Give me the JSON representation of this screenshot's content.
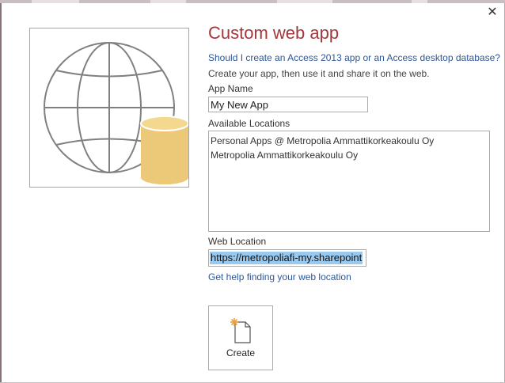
{
  "dialog": {
    "close_glyph": "✕",
    "title": "Custom web app",
    "question_link": "Should I create an Access 2013 app or an Access desktop database?",
    "description": "Create your app, then use it and share it on the web.",
    "app_name": {
      "label": "App Name",
      "value": "My New App"
    },
    "locations": {
      "label": "Available Locations",
      "items": [
        "Personal Apps @ Metropolia Ammattikorkeakoulu Oy",
        "Metropolia Ammattikorkeakoulu Oy"
      ]
    },
    "web_location": {
      "label": "Web Location",
      "value": "https://metropoliafi-my.sharepoint"
    },
    "help_link": "Get help finding your web location",
    "create_label": "Create"
  },
  "colors": {
    "title": "#a4373a",
    "link": "#2b579a",
    "selection": "#99c9ef",
    "globe_stroke": "#808080",
    "database": "#ecc978"
  },
  "icons": {
    "illustration": "globe-with-database",
    "create": "new-document-icon"
  }
}
